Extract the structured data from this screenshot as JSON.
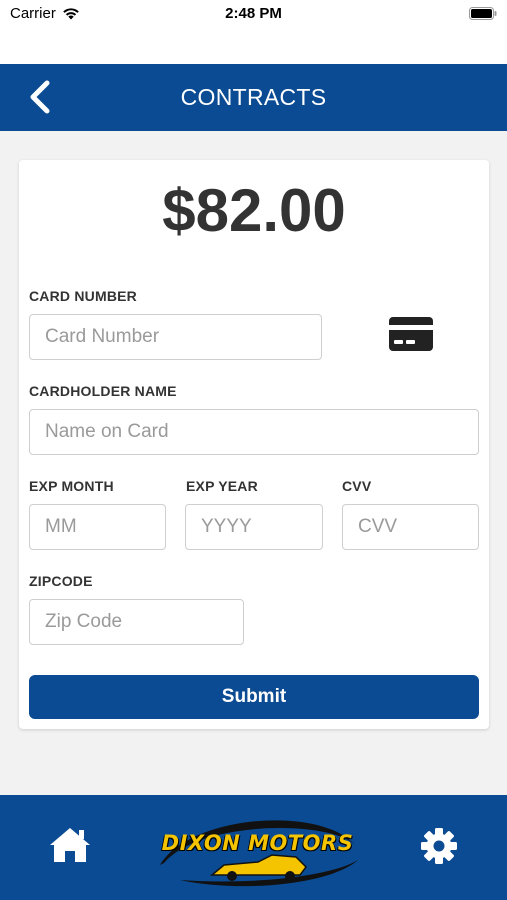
{
  "status_bar": {
    "carrier": "Carrier",
    "time": "2:48 PM"
  },
  "navbar": {
    "title": "CONTRACTS",
    "back_icon": "chevron-left-icon"
  },
  "payment": {
    "amount": "$82.00",
    "card_number": {
      "label": "CARD NUMBER",
      "placeholder": "Card Number",
      "value": ""
    },
    "card_icon": "credit-card-icon",
    "cardholder": {
      "label": "CARDHOLDER NAME",
      "placeholder": "Name on Card",
      "value": ""
    },
    "exp_month": {
      "label": "EXP MONTH",
      "placeholder": "MM",
      "value": ""
    },
    "exp_year": {
      "label": "EXP YEAR",
      "placeholder": "YYYY",
      "value": ""
    },
    "cvv": {
      "label": "CVV",
      "placeholder": "CVV",
      "value": ""
    },
    "zipcode": {
      "label": "ZIPCODE",
      "placeholder": "Zip Code",
      "value": ""
    },
    "submit_label": "Submit"
  },
  "bottom_bar": {
    "home_icon": "home-icon",
    "logo_text": "DIXON MOTORS",
    "settings_icon": "gear-icon"
  },
  "colors": {
    "brand_blue": "#0b4b93",
    "logo_yellow": "#f4c400"
  }
}
